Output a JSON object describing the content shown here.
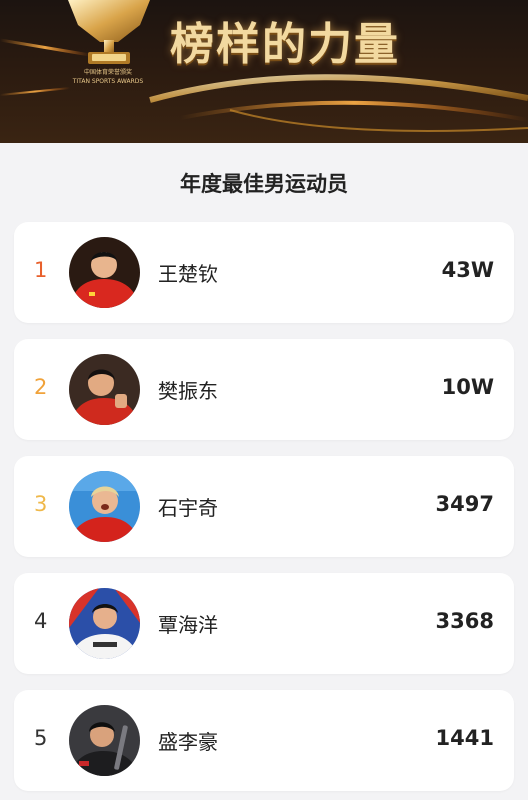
{
  "banner": {
    "title": "榜样的力量",
    "trophy_caption_line1": "中国体育荣誉颁奖",
    "trophy_caption_line2": "TITAN SPORTS AWARDS",
    "trophy_badge": "TITAN"
  },
  "section_title": "年度最佳男运动员",
  "ranking": [
    {
      "rank": "1",
      "name": "王楚钦",
      "votes": "43W"
    },
    {
      "rank": "2",
      "name": "樊振东",
      "votes": "10W"
    },
    {
      "rank": "3",
      "name": "石宇奇",
      "votes": "3497"
    },
    {
      "rank": "4",
      "name": "覃海洋",
      "votes": "3368"
    },
    {
      "rank": "5",
      "name": "盛李豪",
      "votes": "1441"
    }
  ],
  "colors": {
    "rank1": "#e8602c",
    "rank2": "#f0a23a",
    "rank3": "#efb84a",
    "banner_gold": "#f2d9a0",
    "page_bg": "#f3f3f5"
  }
}
